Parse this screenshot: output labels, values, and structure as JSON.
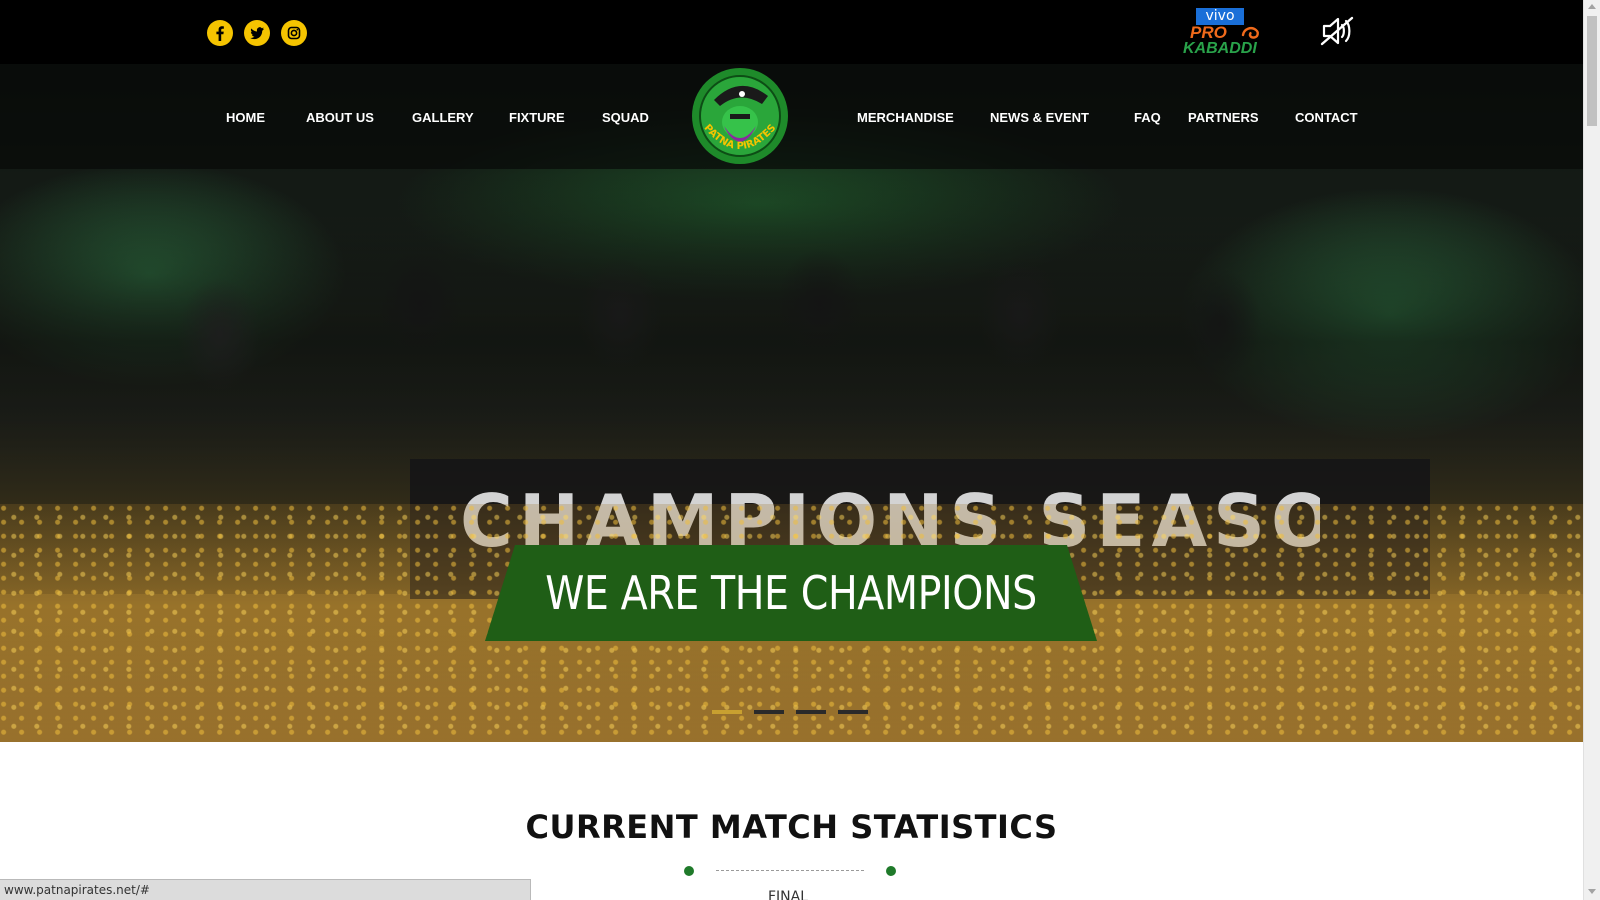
{
  "social": {
    "facebook_icon": "facebook-icon",
    "twitter_icon": "twitter-icon",
    "instagram_icon": "instagram-icon",
    "accent_color": "#f5c400"
  },
  "league_logo": {
    "vivo": "vivo",
    "pro": "PRO",
    "kabaddi": "KABADDI"
  },
  "mute_icon": "speaker-muted-icon",
  "nav": {
    "left": [
      "HOME",
      "ABOUT US",
      "GALLERY",
      "FIXTURE",
      "SQUAD"
    ],
    "right": [
      "MERCHANDISE",
      "NEWS & EVENT",
      "FAQ",
      "PARTNERS",
      "CONTACT"
    ],
    "team_logo_text": "PATNA PIRATES"
  },
  "hero": {
    "banner_board_text": "CHAMPIONS SEASON IV",
    "ribbon_text": "WE ARE THE CHAMPIONS",
    "ribbon_color": "#1f5e16",
    "slides": 4,
    "active_slide": 1
  },
  "stats": {
    "title": "CURRENT MATCH STATISTICS",
    "subtitle": "FINAL",
    "divider_color": "#1f7a2a"
  },
  "status_bar": {
    "url": "www.patnapirates.net/#"
  }
}
